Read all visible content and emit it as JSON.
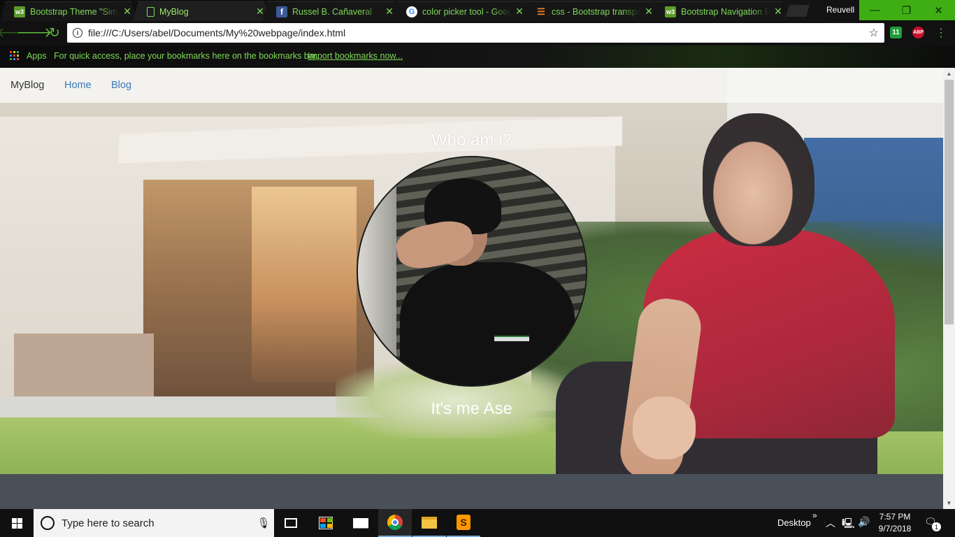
{
  "browser": {
    "tabs": [
      {
        "title": "Bootstrap Theme \"Simp",
        "favicon": "w3schools-icon",
        "active": false
      },
      {
        "title": "MyBlog",
        "favicon": "page-icon",
        "active": true
      },
      {
        "title": "Russel B. Cañaveral",
        "favicon": "facebook-icon",
        "active": false
      },
      {
        "title": "color picker tool - Goog",
        "favicon": "google-icon",
        "active": false
      },
      {
        "title": "css - Bootstrap transpa",
        "favicon": "stackoverflow-icon",
        "active": false
      },
      {
        "title": "Bootstrap Navigation B",
        "favicon": "w3schools-icon",
        "active": false
      }
    ],
    "profile_name": "Reuvell",
    "address": "file:///C:/Users/abel/Documents/My%20webpage/index.html",
    "extension_labels": {
      "calendar": "11",
      "adblock": "ABP"
    },
    "bookmarks_bar": {
      "apps_label": "Apps",
      "message": "For quick access, place your bookmarks here on the bookmarks bar.",
      "import_link": "Import bookmarks now..."
    },
    "accent_color": "#7fd957"
  },
  "page": {
    "navbar": {
      "brand": "MyBlog",
      "links": [
        "Home",
        "Blog"
      ]
    },
    "hero": {
      "heading": "Who am i?",
      "caption": "It's me Ase"
    }
  },
  "taskbar": {
    "search_placeholder": "Type here to search",
    "desktop_label": "Desktop",
    "time": "7:57 PM",
    "date": "9/7/2018",
    "notification_count": "1",
    "pinned_apps": [
      "task-view-icon",
      "store-icon",
      "mail-icon",
      "chrome-icon",
      "file-explorer-icon",
      "sublime-text-icon"
    ]
  }
}
